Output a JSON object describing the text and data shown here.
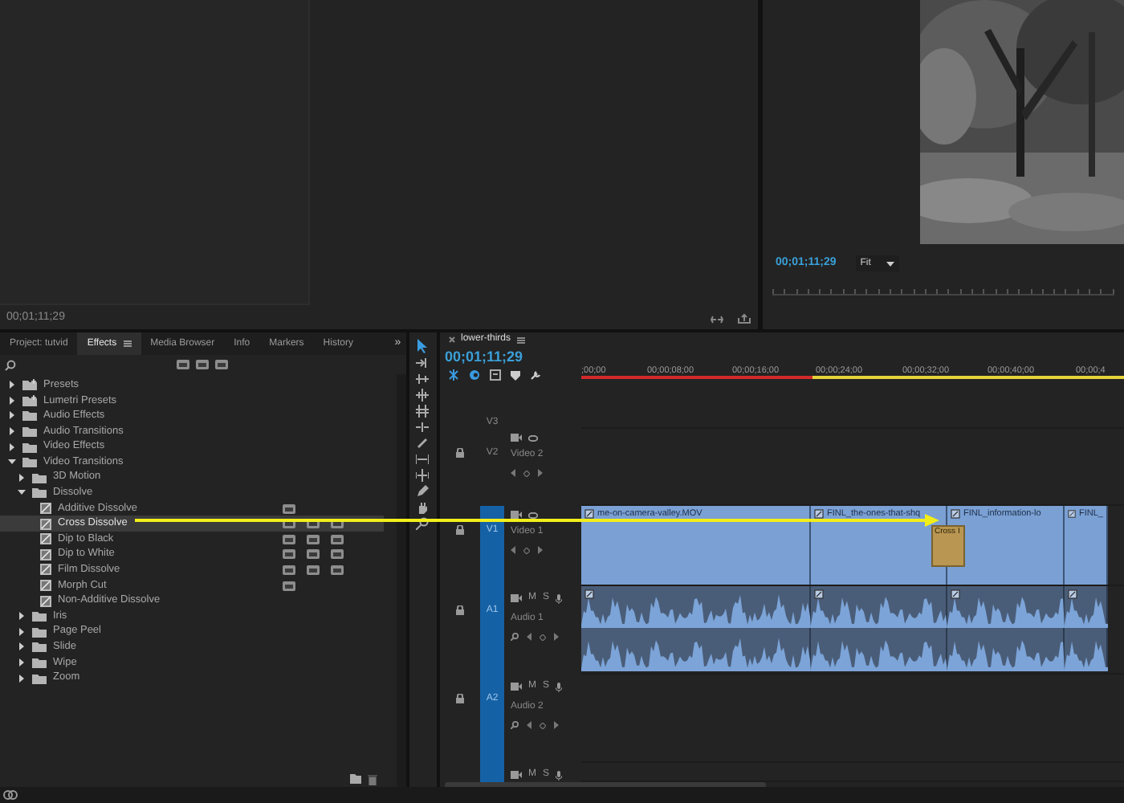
{
  "source_monitor": {
    "timecode": "00;01;11;29"
  },
  "program_monitor": {
    "timecode": "00;01;11;29",
    "zoom": "Fit"
  },
  "effects_panel": {
    "tabs": [
      {
        "label": "Project: tutvid",
        "selected": false
      },
      {
        "label": "Effects",
        "selected": true
      },
      {
        "label": "Media Browser",
        "selected": false
      },
      {
        "label": "Info",
        "selected": false
      },
      {
        "label": "Markers",
        "selected": false
      },
      {
        "label": "History",
        "selected": false
      }
    ],
    "overflow": "»",
    "tree": [
      {
        "label": "Presets",
        "kind": "preset",
        "expanded": false
      },
      {
        "label": "Lumetri Presets",
        "kind": "preset",
        "expanded": false
      },
      {
        "label": "Audio Effects",
        "kind": "folder",
        "expanded": false
      },
      {
        "label": "Audio Transitions",
        "kind": "folder",
        "expanded": false
      },
      {
        "label": "Video Effects",
        "kind": "folder",
        "expanded": false
      },
      {
        "label": "Video Transitions",
        "kind": "folder",
        "expanded": true,
        "children": [
          {
            "label": "3D Motion",
            "kind": "folder",
            "expanded": false
          },
          {
            "label": "Dissolve",
            "kind": "folder",
            "expanded": true,
            "children": [
              {
                "label": "Additive Dissolve",
                "kind": "effect",
                "selected": false,
                "accelerated": true,
                "bit32": false,
                "yuv": false
              },
              {
                "label": "Cross Dissolve",
                "kind": "effect",
                "selected": true,
                "accelerated": true,
                "bit32": true,
                "yuv": true
              },
              {
                "label": "Dip to Black",
                "kind": "effect",
                "selected": false,
                "accelerated": true,
                "bit32": true,
                "yuv": true
              },
              {
                "label": "Dip to White",
                "kind": "effect",
                "selected": false,
                "accelerated": true,
                "bit32": true,
                "yuv": true
              },
              {
                "label": "Film Dissolve",
                "kind": "effect",
                "selected": false,
                "accelerated": true,
                "bit32": true,
                "yuv": true
              },
              {
                "label": "Morph Cut",
                "kind": "effect",
                "selected": false,
                "accelerated": true,
                "bit32": false,
                "yuv": false
              },
              {
                "label": "Non-Additive Dissolve",
                "kind": "effect",
                "selected": false,
                "accelerated": false,
                "bit32": false,
                "yuv": false
              }
            ]
          },
          {
            "label": "Iris",
            "kind": "folder",
            "expanded": false
          },
          {
            "label": "Page Peel",
            "kind": "folder",
            "expanded": false
          },
          {
            "label": "Slide",
            "kind": "folder",
            "expanded": false
          },
          {
            "label": "Wipe",
            "kind": "folder",
            "expanded": false
          },
          {
            "label": "Zoom",
            "kind": "folder",
            "expanded": false
          }
        ]
      }
    ]
  },
  "timeline": {
    "tab": "lower-thirds",
    "timecode": "00;01;11;29",
    "ruler": [
      ";00;00",
      "00;00;08;00",
      "00;00;16;00",
      "00;00;24;00",
      "00;00;32;00",
      "00;00;40;00",
      "00;00;4"
    ],
    "tracks": [
      {
        "id": "V3",
        "targeted": false
      },
      {
        "id": "V2",
        "name": "Video 2",
        "kind": "video",
        "targeted": false
      },
      {
        "id": "V1",
        "name": "Video 1",
        "kind": "video",
        "targeted": true,
        "clips": [
          {
            "name": "me-on-camera-valley.MOV"
          },
          {
            "name": "FINL_the-ones-that-shq"
          },
          {
            "name": "FINL_information-lo"
          },
          {
            "name": "FINL_"
          }
        ],
        "transition": "Cross I"
      },
      {
        "id": "A1",
        "name": "Audio 1",
        "kind": "audio",
        "targeted": true,
        "mute": "M",
        "solo": "S",
        "clips": [
          {
            "fx": true
          },
          {
            "fx": true
          },
          {
            "fx": true
          },
          {
            "fx": true
          }
        ]
      },
      {
        "id": "A2",
        "name": "Audio 2",
        "kind": "audio",
        "targeted": true,
        "mute": "M",
        "solo": "S"
      },
      {
        "kind": "audio",
        "targeted": true,
        "mute": "M",
        "solo": "S"
      }
    ]
  }
}
